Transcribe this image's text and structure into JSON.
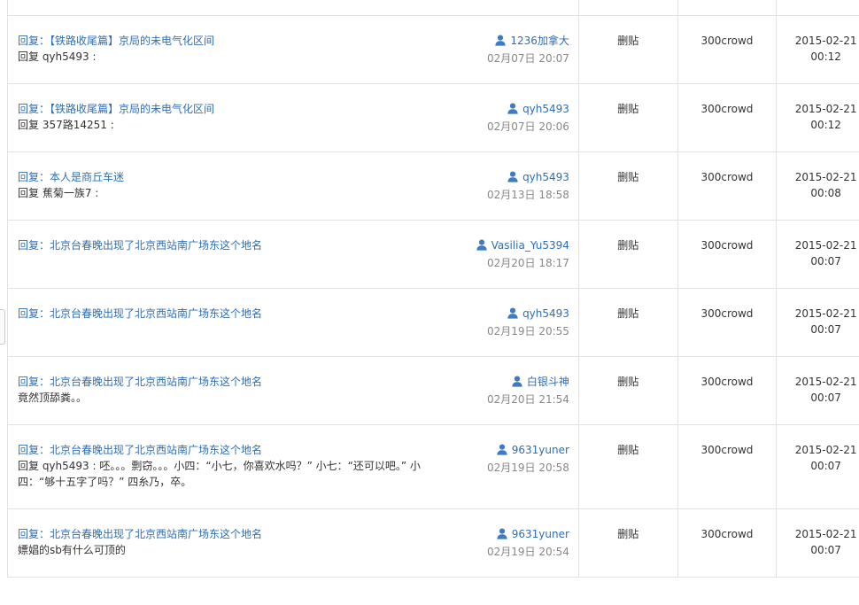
{
  "rows": [
    {
      "title": "回复：【铁路收尾篇】京局的未电气化区间",
      "excerpt": "回复 qyh5493 :",
      "author": "1236加拿大",
      "post_time": "02月07日 20:07",
      "action": "删贴",
      "operator": "300crowd",
      "op_date": "2015-02-21",
      "op_time": "00:12",
      "height": 77
    },
    {
      "title": "回复：【铁路收尾篇】京局的未电气化区间",
      "excerpt": "回复 357路14251 :",
      "author": "qyh5493",
      "post_time": "02月07日 20:06",
      "action": "删贴",
      "operator": "300crowd",
      "op_date": "2015-02-21",
      "op_time": "00:12",
      "height": 77
    },
    {
      "title": "回复：本人是商丘车迷",
      "excerpt": "回复 蕉菊一族7 :",
      "author": "qyh5493",
      "post_time": "02月13日 18:58",
      "action": "删贴",
      "operator": "300crowd",
      "op_date": "2015-02-21",
      "op_time": "00:08",
      "height": 77
    },
    {
      "title": "回复：北京台春晚出现了北京西站南广场东这个地名",
      "excerpt": "",
      "author": "Vasilia_Yu5394",
      "post_time": "02月20日 18:17",
      "action": "删贴",
      "operator": "300crowd",
      "op_date": "2015-02-21",
      "op_time": "00:07",
      "height": 77
    },
    {
      "title": "回复：北京台春晚出现了北京西站南广场东这个地名",
      "excerpt": "",
      "author": "qyh5493",
      "post_time": "02月19日 20:55",
      "action": "删贴",
      "operator": "300crowd",
      "op_date": "2015-02-21",
      "op_time": "00:07",
      "height": 77
    },
    {
      "title": "回复：北京台春晚出现了北京西站南广场东这个地名",
      "excerpt": "竟然顶舔粪。。",
      "author": "白银斗神",
      "post_time": "02月20日 21:54",
      "action": "删贴",
      "operator": "300crowd",
      "op_date": "2015-02-21",
      "op_time": "00:07",
      "height": 77
    },
    {
      "title": "回复：北京台春晚出现了北京西站南广场东这个地名",
      "excerpt": "回复 qyh5493 : 呸。。。剽窃。。。小四：“小七，你喜欢水吗？” 小七：“还可以吧。” 小四：“够十五字了吗？” 四糸乃，卒。",
      "author": "9631yuner",
      "post_time": "02月19日 20:58",
      "action": "删贴",
      "operator": "300crowd",
      "op_date": "2015-02-21",
      "op_time": "00:07",
      "height": 95
    },
    {
      "title": "回复：北京台春晚出现了北京西站南广场东这个地名",
      "excerpt": "嫖娼的sb有什么可顶的",
      "author": "9631yuner",
      "post_time": "02月19日 20:54",
      "action": "删贴",
      "operator": "300crowd",
      "op_date": "2015-02-21",
      "op_time": "00:07",
      "height": 77
    }
  ],
  "icons": {
    "user": "user-icon"
  },
  "colors": {
    "link": "#2f6eb5",
    "muted": "#888888",
    "border": "#e2e2e2"
  }
}
